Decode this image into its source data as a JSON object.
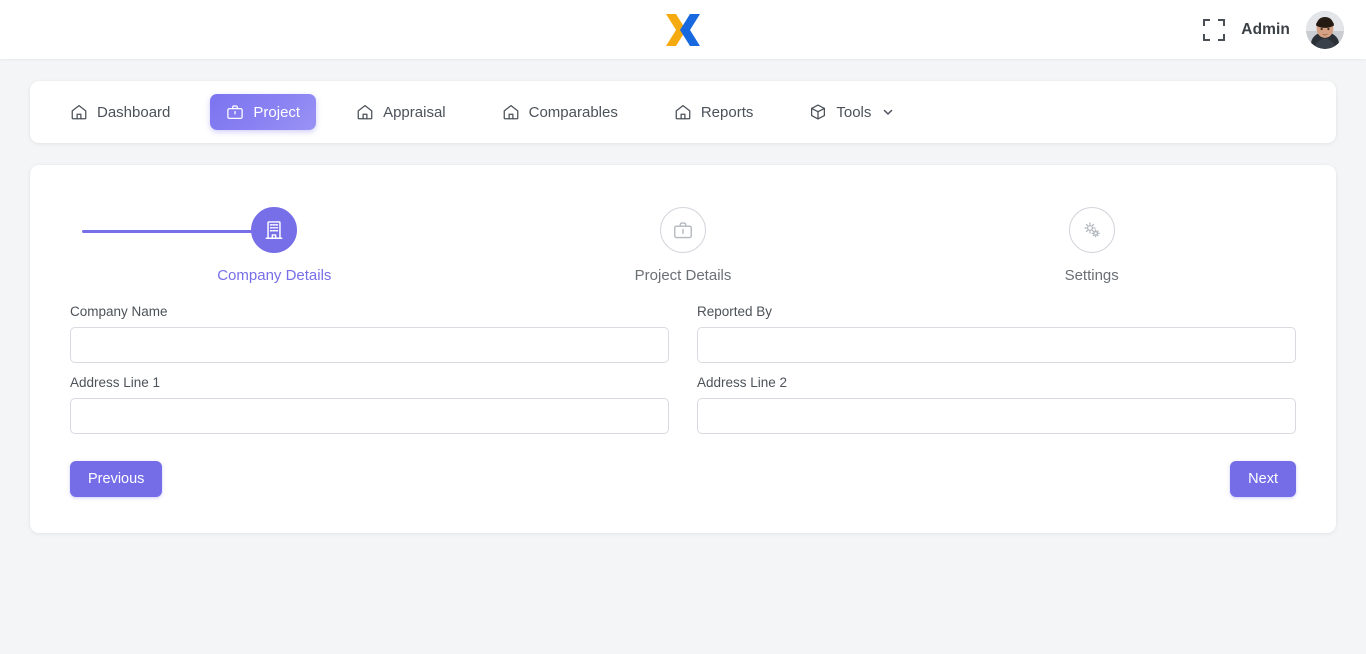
{
  "topbar": {
    "logo_name": "logo-x",
    "logo_colors": {
      "left": "#f5ab10",
      "right": "#1868e0"
    },
    "fullscreen_icon": "fullscreen-icon",
    "admin_label": "Admin",
    "avatar_name": "avatar"
  },
  "nav": {
    "items": [
      {
        "label": "Dashboard",
        "icon": "home-icon",
        "active": false,
        "caret": false
      },
      {
        "label": "Project",
        "icon": "briefcase-icon",
        "active": true,
        "caret": false
      },
      {
        "label": "Appraisal",
        "icon": "home-icon",
        "active": false,
        "caret": false
      },
      {
        "label": "Comparables",
        "icon": "home-icon",
        "active": false,
        "caret": false
      },
      {
        "label": "Reports",
        "icon": "home-icon",
        "active": false,
        "caret": false
      },
      {
        "label": "Tools",
        "icon": "box-icon",
        "active": false,
        "caret": true
      }
    ]
  },
  "wizard": {
    "steps": [
      {
        "label": "Company Details",
        "icon": "building-icon",
        "state": "done"
      },
      {
        "label": "Project Details",
        "icon": "briefcase-icon",
        "state": "todo"
      },
      {
        "label": "Settings",
        "icon": "gears-icon",
        "state": "todo"
      }
    ],
    "accent_color": "#776fe8",
    "inactive_color": "#b3b8bf",
    "fields": [
      {
        "label": "Company Name",
        "value": "",
        "placeholder": ""
      },
      {
        "label": "Reported By",
        "value": "",
        "placeholder": ""
      },
      {
        "label": "Address Line 1",
        "value": "",
        "placeholder": ""
      },
      {
        "label": "Address Line 2",
        "value": "",
        "placeholder": ""
      }
    ],
    "previous_label": "Previous",
    "next_label": "Next"
  }
}
